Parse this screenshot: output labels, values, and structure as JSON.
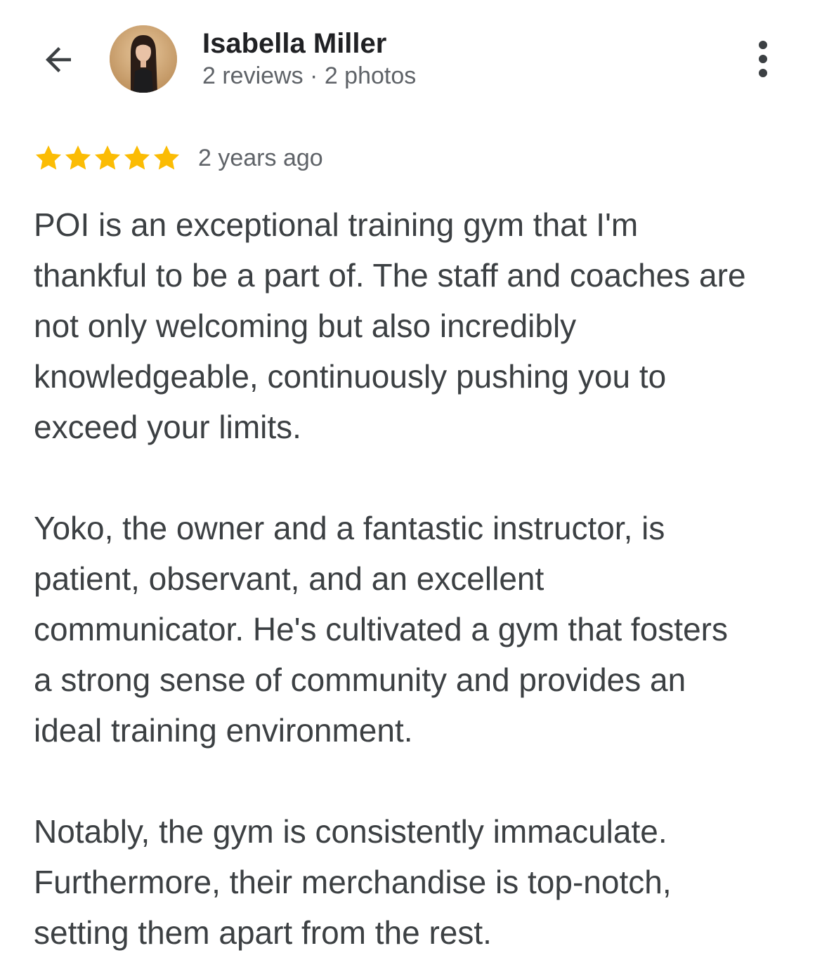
{
  "header": {
    "back_icon": "arrow-back-icon",
    "user_name": "Isabella Miller",
    "user_meta": "2 reviews · 2 photos",
    "more_icon": "more-vert-icon"
  },
  "review": {
    "rating": 5,
    "rating_max": 5,
    "star_color": "#fbbc04",
    "time": "2 years ago",
    "paragraphs": [
      {
        "lines": [
          "POI is an exceptional training gym that I'm",
          "thankful to be a part of. The staff and coaches are",
          "not only welcoming but also incredibly",
          "knowledgeable, continuously pushing you to",
          "exceed your limits."
        ]
      },
      {
        "lines": [
          "Yoko, the owner and a fantastic instructor, is",
          "patient, observant, and an excellent",
          "communicator. He's cultivated a gym that fosters",
          "a strong sense of community and provides an",
          "ideal training environment."
        ]
      },
      {
        "lines": [
          "Notably, the gym is consistently immaculate.",
          "Furthermore, their merchandise is top-notch,",
          "setting them apart from the rest."
        ]
      }
    ]
  }
}
